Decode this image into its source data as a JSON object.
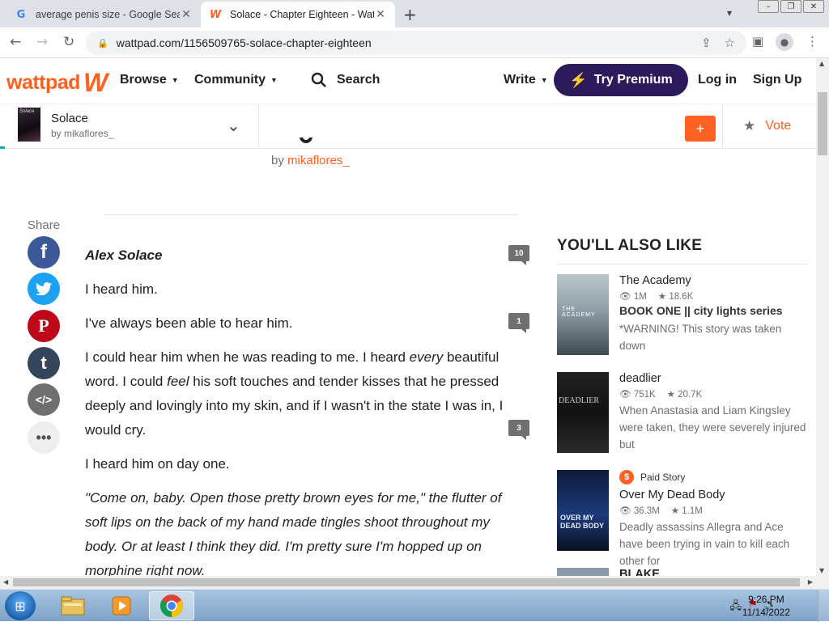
{
  "browser": {
    "tabs": [
      {
        "title": "average penis size - Google Sear",
        "favicon": "google-g-icon",
        "active": false
      },
      {
        "title": "Solace - Chapter Eighteen - Watt",
        "favicon": "wattpad-w-icon",
        "active": true
      }
    ],
    "url": "wattpad.com/1156509765-solace-chapter-eighteen"
  },
  "header": {
    "logo": "wattpad",
    "browse": "Browse",
    "community": "Community",
    "search": "Search",
    "write": "Write",
    "premium": "Try Premium",
    "login": "Log in",
    "signup": "Sign Up"
  },
  "storybar": {
    "title": "Solace",
    "author": "by mikaflores_",
    "cover_text": "Solace",
    "add": "+",
    "vote": "Vote"
  },
  "byline": {
    "prefix": "by ",
    "author": "mikaflores_"
  },
  "share": {
    "label": "Share"
  },
  "story": {
    "heading": "Alex Solace",
    "p1": "I heard him.",
    "p2": "I've always been able to hear him.",
    "p3a": "I could hear him when he was reading to me. I heard ",
    "p3b": "every",
    "p3c": " beautiful word. I could ",
    "p3d": "feel",
    "p3e": " his soft touches and tender kisses that he pressed deeply and lovingly into my skin, and if I wasn't in the state I was in, I would cry.",
    "p4": "I heard him on day one.",
    "p5": "\"Come on, baby. Open those pretty brown eyes for me,\" the flutter of soft lips on the back of my hand made tingles shoot throughout my body. Or at least I think they did. I'm pretty sure I'm hopped up on morphine right now.",
    "comments": [
      "10",
      "1",
      "3"
    ]
  },
  "recommendations": {
    "heading": "YOU'LL ALSO LIKE",
    "items": [
      {
        "title": "The Academy",
        "reads": "1M",
        "votes": "18.6K",
        "tagline": "BOOK ONE || city lights series",
        "desc": "*WARNING! This story was taken down",
        "cover_text": "THE ACADEMY"
      },
      {
        "title": "deadlier",
        "reads": "751K",
        "votes": "20.7K",
        "desc": "When Anastasia and Liam Kingsley were taken, they were severely injured but",
        "cover_text": "DEADLIER"
      },
      {
        "title": "Over My Dead Body",
        "paid": "Paid Story",
        "coin": "$",
        "reads": "36.3M",
        "votes": "1.1M",
        "desc": "Deadly assassins Allegra and Ace have been trying in vain to kill each other for",
        "cover_text": "OVER MY DEAD BODY"
      },
      {
        "title": "BLAKE"
      }
    ]
  },
  "taskbar": {
    "time": "9:26 PM",
    "date": "11/14/2022"
  },
  "colors": {
    "brand_orange": "#ff6122",
    "premium_purple": "#2c1b5b",
    "facebook": "#3b5998",
    "twitter": "#1da1f2",
    "pinterest": "#bd081c",
    "tumblr": "#35465c",
    "embed": "#6f6f6f"
  }
}
